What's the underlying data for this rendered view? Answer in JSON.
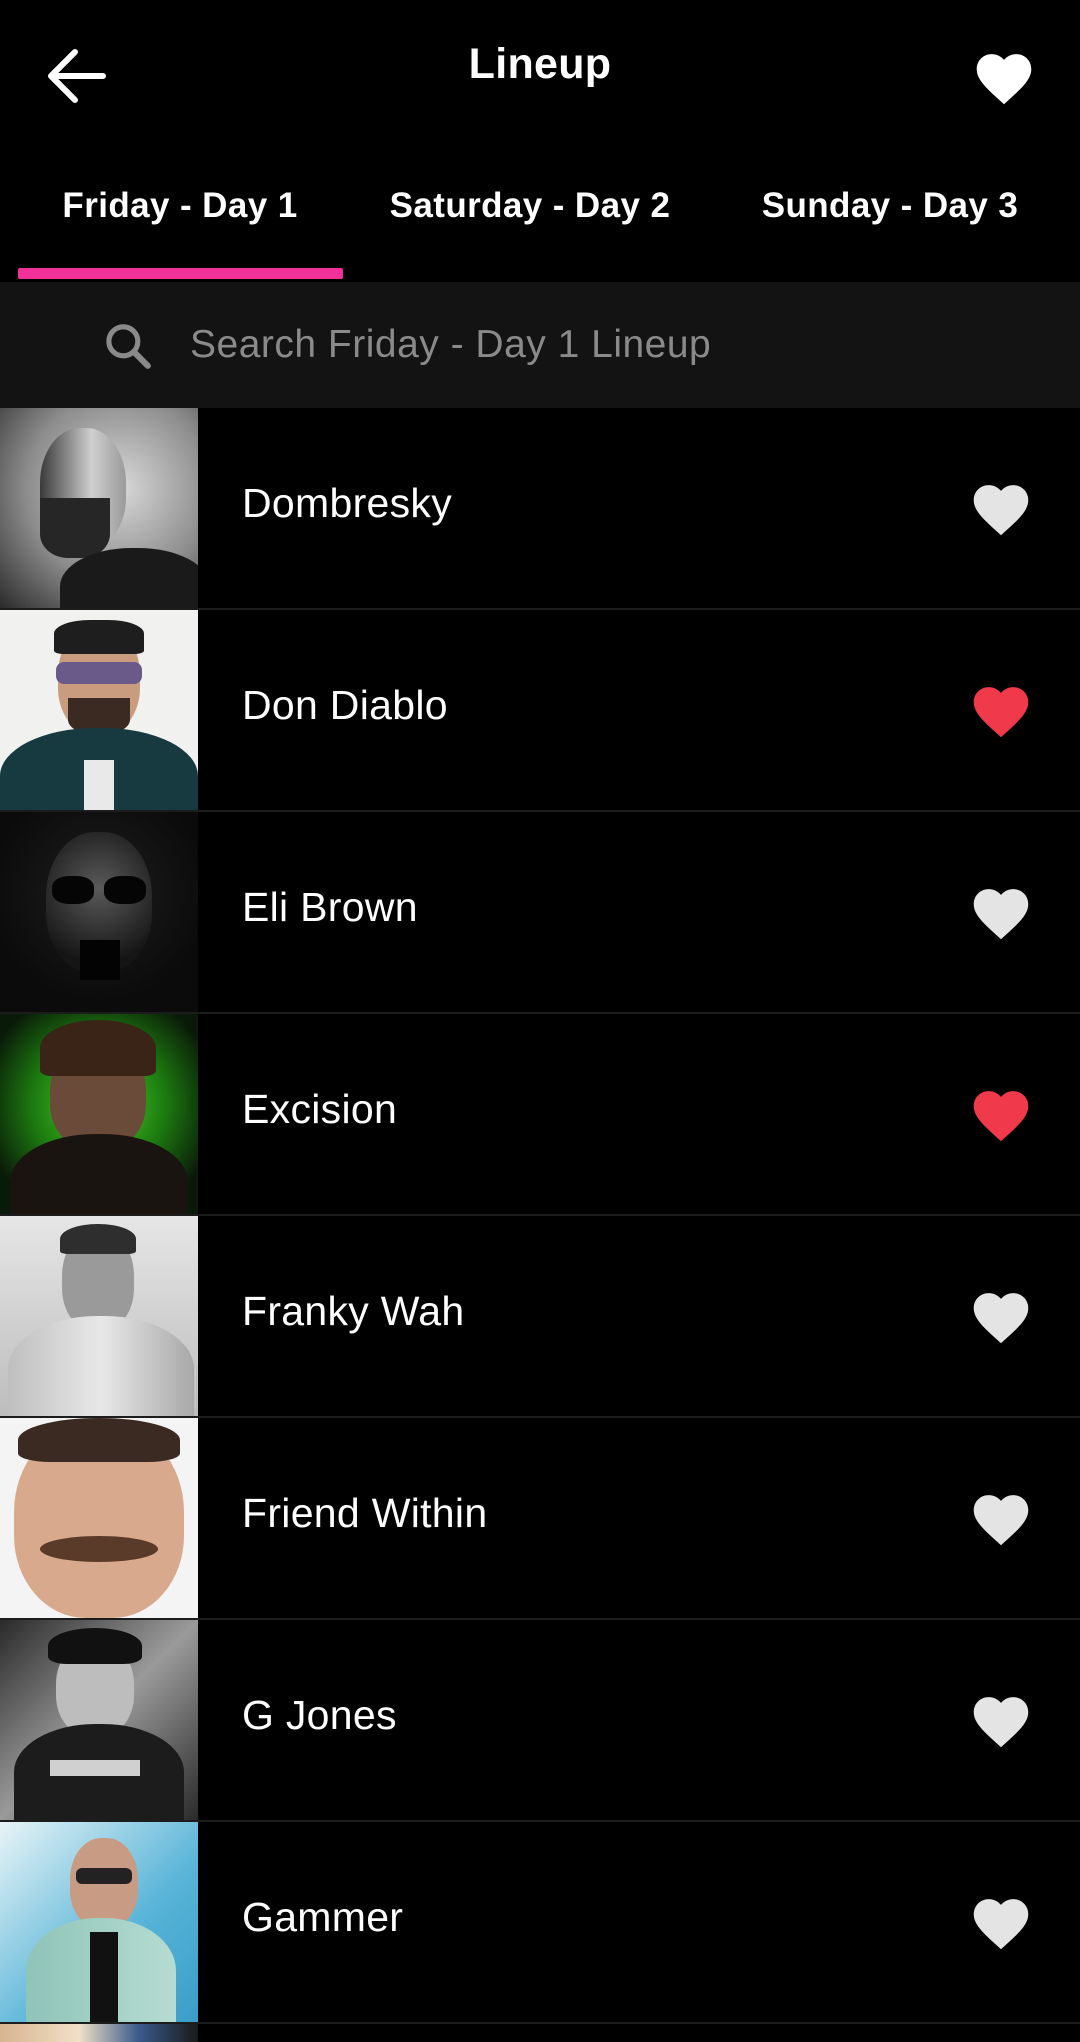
{
  "header": {
    "title": "Lineup",
    "back_icon": "arrow-left-icon",
    "favorites_icon": "heart-icon"
  },
  "tabs": [
    {
      "label": "Friday - Day 1",
      "selected": true
    },
    {
      "label": "Saturday - Day 2",
      "selected": false
    },
    {
      "label": "Sunday - Day 3",
      "selected": false
    }
  ],
  "accent_color": "#f2309a",
  "favorite_color": "#f0394a",
  "unfavorite_color": "#e4e4e4",
  "search": {
    "placeholder": "Search Friday - Day 1 Lineup",
    "value": "",
    "icon": "search-icon"
  },
  "artists": [
    {
      "name": "Dombresky",
      "favorited": false
    },
    {
      "name": "Don Diablo",
      "favorited": true
    },
    {
      "name": "Eli Brown",
      "favorited": false
    },
    {
      "name": "Excision",
      "favorited": true
    },
    {
      "name": "Franky Wah",
      "favorited": false
    },
    {
      "name": "Friend Within",
      "favorited": false
    },
    {
      "name": "G Jones",
      "favorited": false
    },
    {
      "name": "Gammer",
      "favorited": false
    }
  ]
}
